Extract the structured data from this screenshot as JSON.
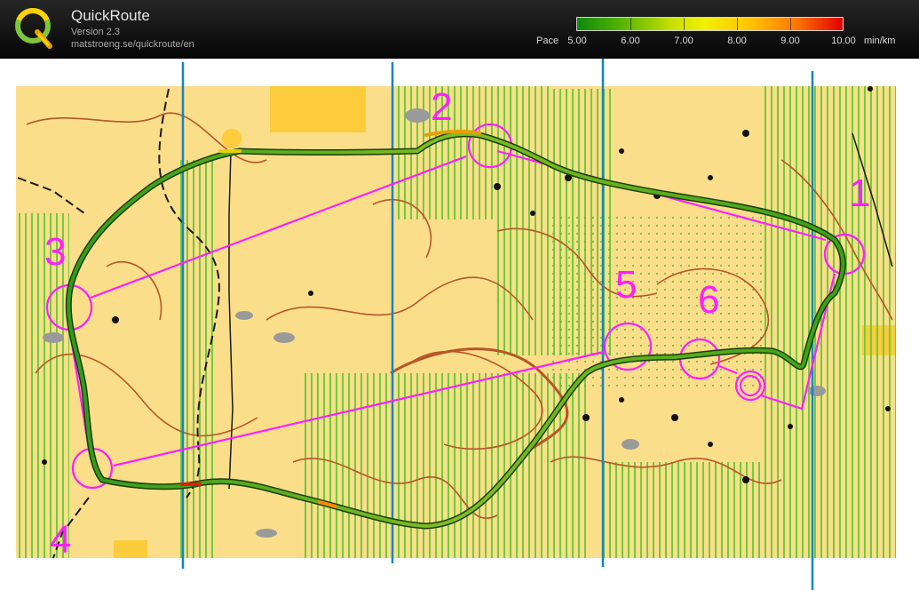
{
  "app": {
    "title": "QuickRoute",
    "version": "Version 2.3",
    "url": "matstroeng.se/quickroute/en"
  },
  "pace_legend": {
    "label": "Pace",
    "unit": "min/km",
    "values": [
      "5.00",
      "6.00",
      "7.00",
      "8.00",
      "9.00",
      "10.00"
    ]
  },
  "map": {
    "control_labels": [
      "1",
      "2",
      "3",
      "4",
      "5",
      "6"
    ],
    "colors": {
      "course_magenta": "#ff1fff",
      "north_lines": "#1784c2",
      "open_land": "#fbde8a",
      "rough_open": "#fccc3c",
      "vegetation_stripes": "#6fcc3c",
      "contours": "#b5562a"
    }
  }
}
